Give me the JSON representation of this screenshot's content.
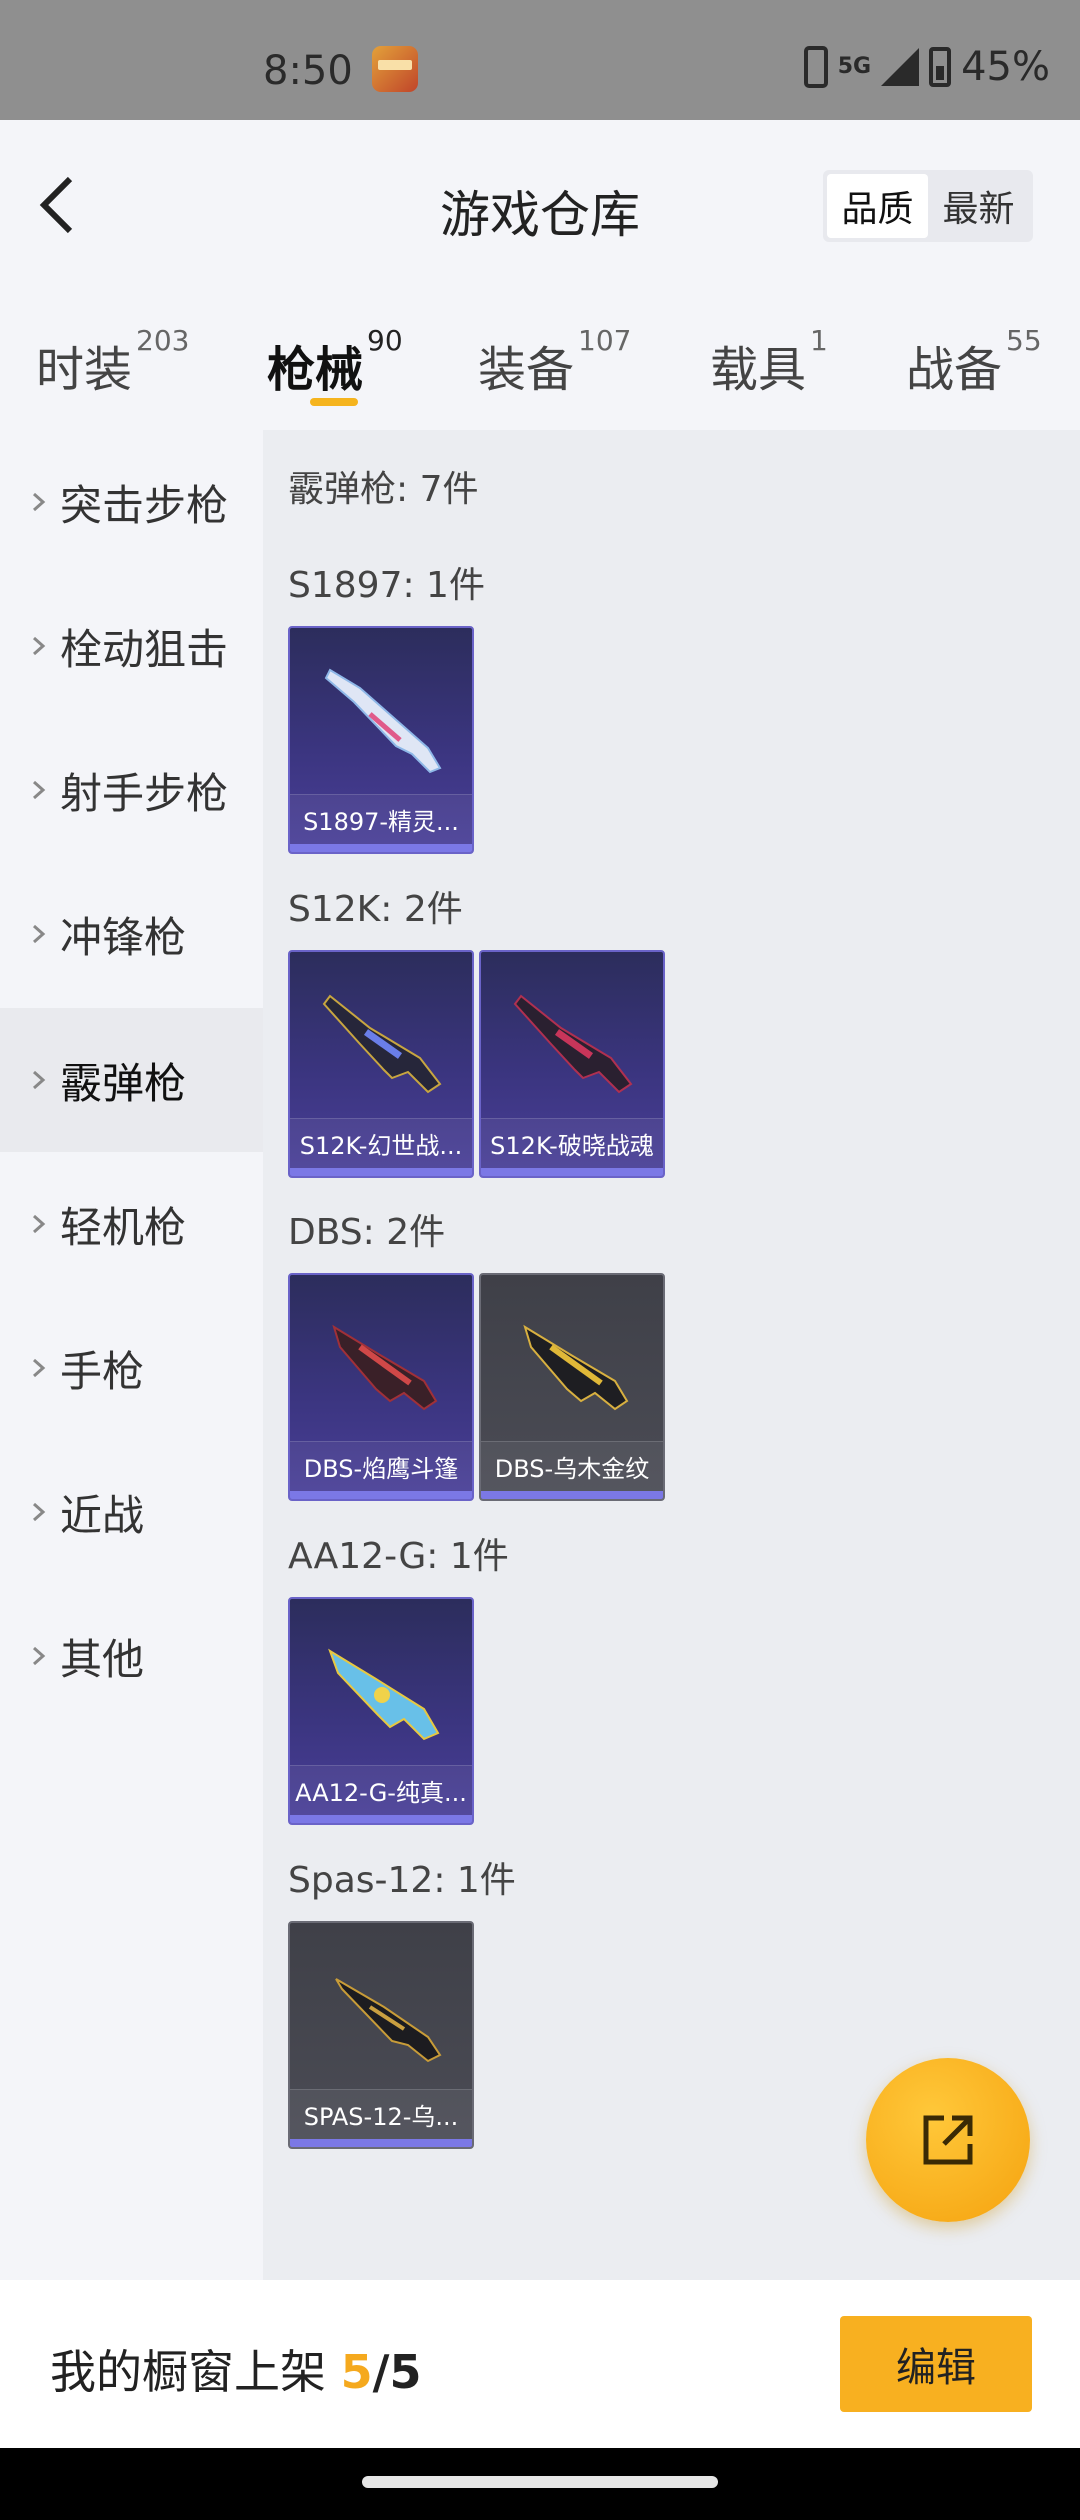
{
  "status_bar": {
    "time": "8:50",
    "network": "5G",
    "battery": "45%"
  },
  "header": {
    "title": "游戏仓库",
    "sort_options": [
      "品质",
      "最新"
    ],
    "sort_active": "品质"
  },
  "tabs": [
    {
      "label": "时装",
      "count": "203"
    },
    {
      "label": "枪械",
      "count": "90",
      "active": true
    },
    {
      "label": "装备",
      "count": "107"
    },
    {
      "label": "载具",
      "count": "1"
    },
    {
      "label": "战备",
      "count": "55"
    }
  ],
  "sidebar": {
    "items": [
      "突击步枪",
      "栓动狙击",
      "射手步枪",
      "冲锋枪",
      "霰弹枪",
      "轻机枪",
      "手枪",
      "近战",
      "其他"
    ],
    "active": "霰弹枪"
  },
  "content": {
    "summary": "霰弹枪: 7件",
    "groups": [
      {
        "label": "S1897: 1件",
        "items": [
          {
            "name": "S1897-精灵...",
            "rarity": "purple"
          }
        ]
      },
      {
        "label": "S12K: 2件",
        "items": [
          {
            "name": "S12K-幻世战...",
            "rarity": "purple"
          },
          {
            "name": "S12K-破晓战魂",
            "rarity": "purple"
          }
        ]
      },
      {
        "label": "DBS: 2件",
        "items": [
          {
            "name": "DBS-焰鹰斗篷",
            "rarity": "purple"
          },
          {
            "name": "DBS-乌木金纹",
            "rarity": "gray"
          }
        ]
      },
      {
        "label": "AA12-G: 1件",
        "items": [
          {
            "name": "AA12-G-纯真...",
            "rarity": "purple"
          }
        ]
      },
      {
        "label": "Spas-12: 1件",
        "items": [
          {
            "name": "SPAS-12-乌...",
            "rarity": "gray"
          }
        ]
      }
    ]
  },
  "bottom_bar": {
    "label": "我的橱窗上架",
    "current": "5",
    "separator": "/",
    "total": "5",
    "edit_label": "编辑"
  },
  "colors": {
    "accent": "#f5b41e",
    "purple_card": "#3b3580",
    "gray_card": "#4b4c55"
  }
}
